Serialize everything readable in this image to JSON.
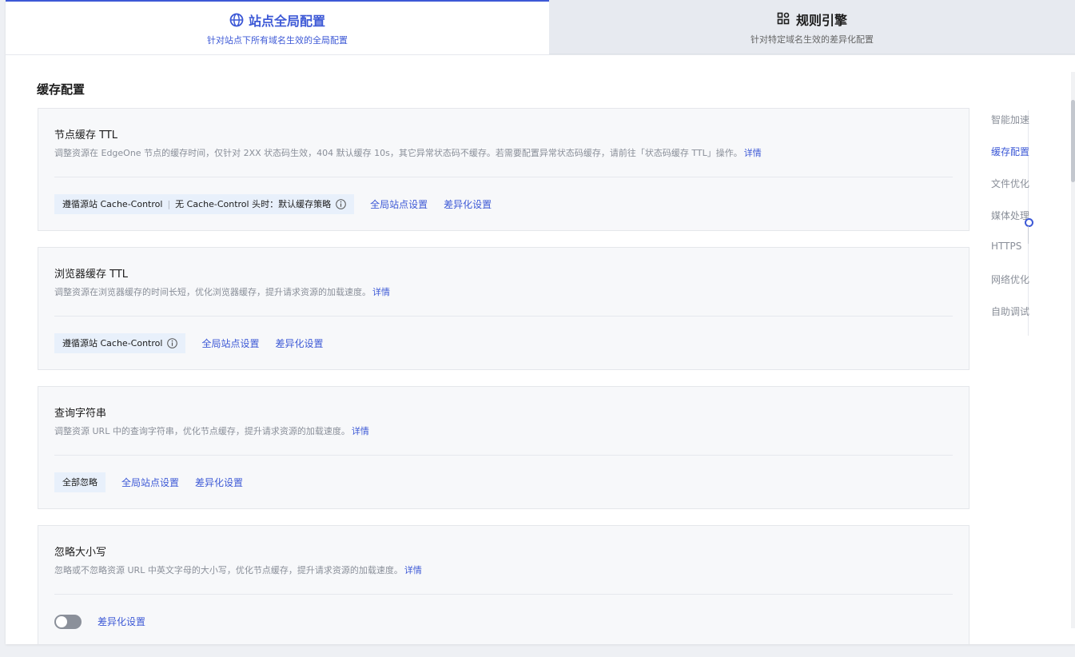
{
  "tabs": [
    {
      "title": "站点全局配置",
      "subtitle": "针对站点下所有域名生效的全局配置",
      "icon": "globe-icon",
      "active": true
    },
    {
      "title": "规则引擎",
      "subtitle": "针对特定域名生效的差异化配置",
      "icon": "grid-icon",
      "active": false
    }
  ],
  "section_title": "缓存配置",
  "cards": [
    {
      "title": "节点缓存 TTL",
      "description": "调整资源在 EdgeOne 节点的缓存时间，仅针对 2XX 状态码生效，404 默认缓存 10s，其它异常状态码不缓存。若需要配置异常状态码缓存，请前往「状态码缓存 TTL」操作。",
      "detail_link": "详情",
      "tag_part1": "遵循源站 Cache-Control",
      "tag_sep": "|",
      "tag_part2": "无 Cache-Control 头时：默认缓存策略",
      "global_link": "全局站点设置",
      "diff_link": "差异化设置"
    },
    {
      "title": "浏览器缓存 TTL",
      "description": "调整资源在浏览器缓存的时间长短，优化浏览器缓存，提升请求资源的加载速度。",
      "detail_link": "详情",
      "tag_part1": "遵循源站 Cache-Control",
      "global_link": "全局站点设置",
      "diff_link": "差异化设置"
    },
    {
      "title": "查询字符串",
      "description": "调整资源 URL 中的查询字符串，优化节点缓存，提升请求资源的加载速度。",
      "detail_link": "详情",
      "tag_part1": "全部忽略",
      "global_link": "全局站点设置",
      "diff_link": "差异化设置"
    },
    {
      "title": "忽略大小写",
      "description": "忽略或不忽略资源 URL 中英文字母的大小写，优化节点缓存，提升请求资源的加载速度。",
      "detail_link": "详情",
      "toggle_on": false,
      "diff_link": "差异化设置"
    }
  ],
  "right_nav": {
    "items": [
      "智能加速",
      "缓存配置",
      "文件优化",
      "媒体处理",
      "HTTPS",
      "网络优化",
      "自助调试"
    ],
    "active": "缓存配置"
  },
  "colors": {
    "accent": "#3d59d6",
    "tag_bg": "#e8f0fb",
    "card_bg": "#f7f8fa"
  }
}
